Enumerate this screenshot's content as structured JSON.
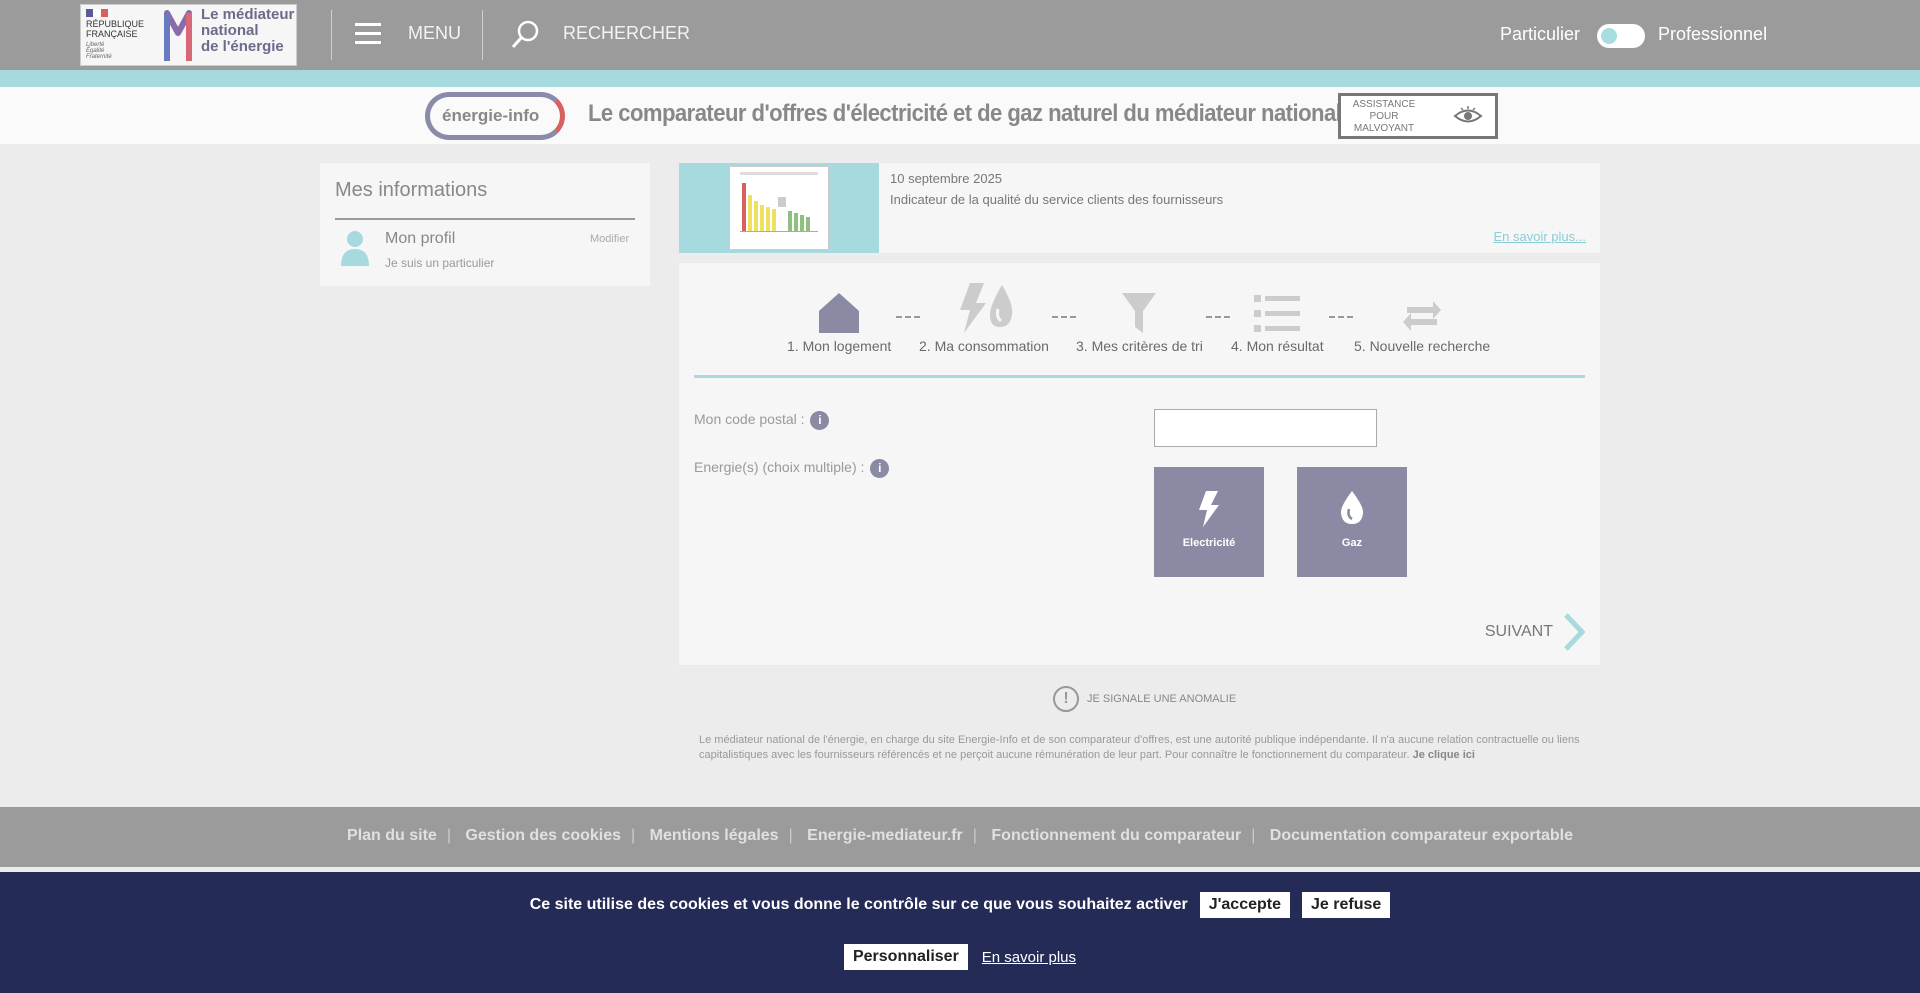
{
  "header": {
    "republique": [
      "RÉPUBLIQUE",
      "FRANÇAISE"
    ],
    "motto": [
      "Liberté",
      "Égalité",
      "Fraternité"
    ],
    "mediateur_lines": [
      "Le médiateur",
      "national",
      "de l'énergie"
    ],
    "menu_label": "MENU",
    "search_label": "RECHERCHER",
    "particulier": "Particulier",
    "professionnel": "Professionnel"
  },
  "banner": {
    "logo_text": "énergie-info",
    "title": "Le comparateur d'offres d'électricité et de gaz naturel du médiateur national de l'énergie",
    "assistance_label": "ASSISTANCE POUR MALVOYANT"
  },
  "sidebar": {
    "title": "Mes informations",
    "profile_name": "Mon profil",
    "profile_sub": "Je suis un particulier",
    "edit_label": "Modifier"
  },
  "news": {
    "date": "10 septembre 2025",
    "title": "Indicateur de la qualité du service clients des fournisseurs",
    "more": "En savoir plus..."
  },
  "steps": [
    {
      "label": "1.  Mon logement",
      "icon": "house-icon"
    },
    {
      "label": "2.  Ma consommation",
      "icon": "energy-icon"
    },
    {
      "label": "3.  Mes critères de tri",
      "icon": "filter-icon"
    },
    {
      "label": "4.  Mon résultat",
      "icon": "list-icon"
    },
    {
      "label": "5.  Nouvelle recherche",
      "icon": "repeat-icon"
    }
  ],
  "form": {
    "postal_label": "Mon code postal :",
    "postal_value": "",
    "energy_label": "Energie(s) (choix multiple) :",
    "energy_options": [
      "Electricité",
      "Gaz"
    ],
    "next_label": "SUIVANT"
  },
  "anomalie": "JE SIGNALE UNE ANOMALIE",
  "disclaimer": {
    "text": "Le médiateur national de l'énergie, en charge du site Energie-Info et de son comparateur d'offres, est une autorité publique indépendante. Il n'a aucune relation contractuelle ou liens capitalistiques avec les fournisseurs référencés et ne perçoit aucune rémunération de leur part. Pour connaître le fonctionnement du comparateur.",
    "link": "Je clique ici"
  },
  "footer": {
    "links": [
      "Plan du site",
      "Gestion des cookies",
      "Mentions légales",
      "Energie-mediateur.fr",
      "Fonctionnement du comparateur",
      "Documentation comparateur exportable"
    ]
  },
  "cookies": {
    "text": "Ce site utilise des cookies et vous donne le contrôle sur ce que vous souhaitez activer",
    "accept": " J'accepte",
    "refuse": " Je refuse",
    "customize": "Personnaliser",
    "more": "En savoir plus"
  }
}
